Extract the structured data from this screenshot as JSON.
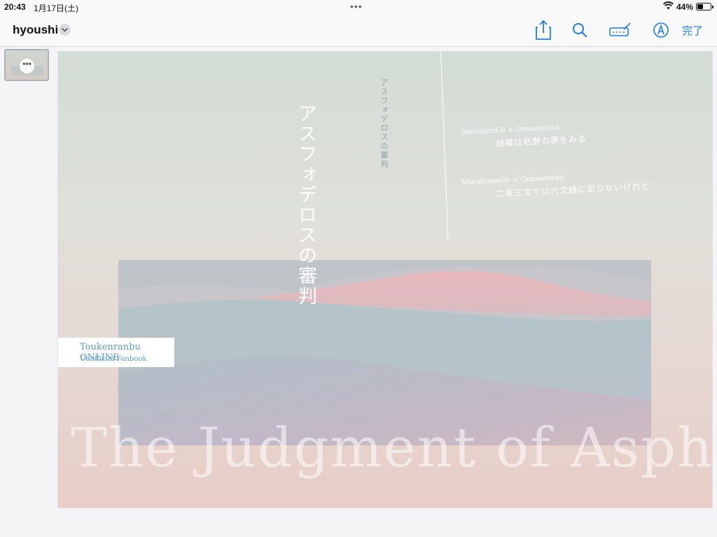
{
  "status_bar": {
    "time": "20:43",
    "date": "1月17日(土)",
    "battery_percent": "44%",
    "battery_level": 0.44
  },
  "toolbar": {
    "title": "hyoushi",
    "done_label": "完了",
    "accent_color": "#1a7ef0"
  },
  "icons": [
    "share-icon",
    "search-icon",
    "pencil-keyboard-icon",
    "markup-icon",
    "chevron-down-icon",
    "more-icon"
  ],
  "sidebar": {
    "more_label": "•••"
  },
  "page": {
    "vertical_title": "アスフォデロスの審判",
    "vertical_subtitle": "アスフォデロスの審判",
    "stories": [
      {
        "pair": "SamidareGo × Onnasaniwa",
        "title": "胡蝶は枯野の夢をみる"
      },
      {
        "pair": "MurakumoGo × Onnasaniwa",
        "title": "二束三文では六文銭に足りないけれど"
      }
    ],
    "label_line1": "Toukenranbu ONLINE",
    "label_line2": "Unofficial Fanbook",
    "english_title": "The Judgment of Asphodel"
  }
}
